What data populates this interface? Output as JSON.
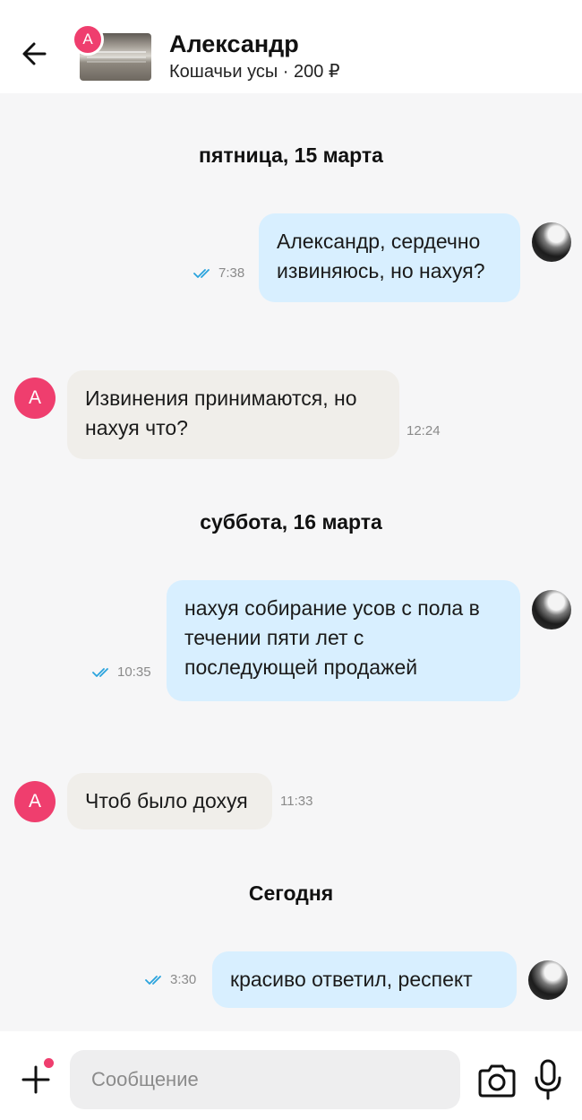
{
  "header": {
    "contact_name": "Александр",
    "listing_info": "Кошачьи усы · 200 ₽",
    "avatar_letter": "А"
  },
  "chat": {
    "date_1": "пятница, 15 марта",
    "date_2": "суббота, 16 марта",
    "date_3": "Сегодня",
    "m1": {
      "lines": [
        "Александр, сердечно",
        "извиняюсь, но нахуя?"
      ],
      "time": "7:38"
    },
    "m2": {
      "lines": [
        "Извинения принимаются, но",
        "нахуя что?"
      ],
      "time": "12:24",
      "avatar_letter": "А"
    },
    "m3": {
      "lines": [
        "нахуя собирание усов с пола в",
        "течении пяти лет с",
        "последующей продажей"
      ],
      "time": "10:35"
    },
    "m4": {
      "lines": [
        "Чтоб было дохуя"
      ],
      "time": "11:33",
      "avatar_letter": "А"
    },
    "m5": {
      "lines": [
        "красиво ответил, респект"
      ],
      "time": "3:30"
    }
  },
  "composer": {
    "placeholder": "Сообщение"
  },
  "colors": {
    "accent": "#ef3e6e",
    "outgoing_bubble": "#d8efff",
    "incoming_bubble": "#f0eeea",
    "read_check": "#2aa3dd"
  }
}
